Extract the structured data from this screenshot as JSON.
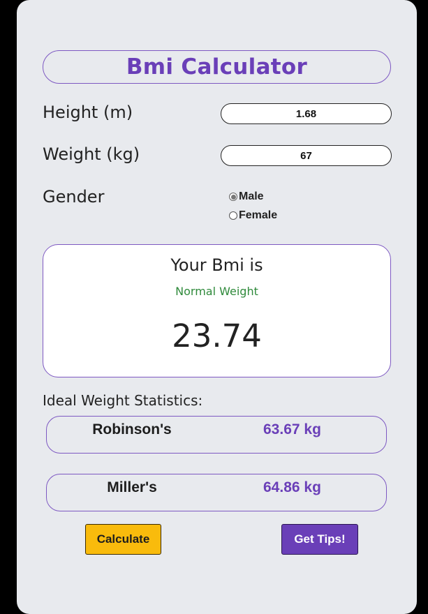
{
  "app": {
    "title": "Bmi Calculator"
  },
  "form": {
    "height_label": "Height (m)",
    "height_value": "1.68",
    "weight_label": "Weight (kg)",
    "weight_value": "67",
    "gender_label": "Gender",
    "gender_options": [
      {
        "label": "Male",
        "selected": true
      },
      {
        "label": "Female",
        "selected": false
      }
    ]
  },
  "result": {
    "heading": "Your Bmi is",
    "category": "Normal Weight",
    "value": "23.74"
  },
  "ideal_weight": {
    "heading": "Ideal Weight Statistics:",
    "rows": [
      {
        "name": "Robinson's",
        "value": "63.67 kg"
      },
      {
        "name": "Miller's",
        "value": "64.86 kg"
      }
    ]
  },
  "actions": {
    "calculate_label": "Calculate",
    "tips_label": "Get Tips!"
  },
  "colors": {
    "accent_purple": "#6a3fb8",
    "accent_yellow": "#f9bb0c",
    "normal_green": "#2f8a3b",
    "card_background": "#e8eaee"
  }
}
